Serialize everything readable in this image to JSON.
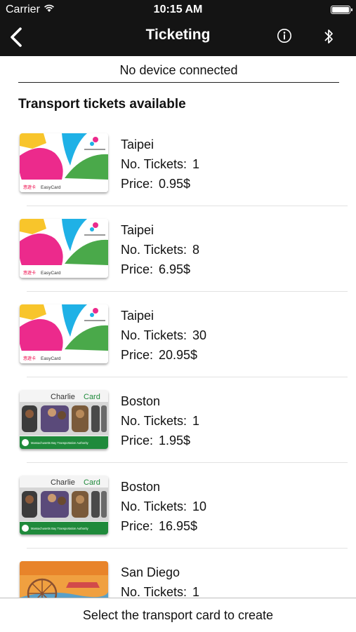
{
  "status_bar": {
    "carrier": "Carrier",
    "time": "10:15 AM"
  },
  "nav": {
    "title": "Ticketing"
  },
  "device_status": "No device connected",
  "section_title": "Transport tickets available",
  "labels": {
    "tickets": "No. Tickets:",
    "price": "Price:"
  },
  "tickets": [
    {
      "city": "Taipei",
      "count": "1",
      "price": "0.95$",
      "card": "easycard"
    },
    {
      "city": "Taipei",
      "count": "8",
      "price": "6.95$",
      "card": "easycard"
    },
    {
      "city": "Taipei",
      "count": "30",
      "price": "20.95$",
      "card": "easycard"
    },
    {
      "city": "Boston",
      "count": "1",
      "price": "1.95$",
      "card": "charliecard"
    },
    {
      "city": "Boston",
      "count": "10",
      "price": "16.95$",
      "card": "charliecard"
    },
    {
      "city": "San Diego",
      "count": "1",
      "price": "",
      "card": "sandiego"
    }
  ],
  "cards": {
    "easycard": {
      "brand": "EasyCard",
      "sub": "悠遊卡",
      "issuer": "台北捷運公司"
    },
    "charliecard": {
      "brand_a": "Charlie",
      "brand_b": "Card",
      "authority": "Massachusetts Bay Transportation Authority"
    }
  },
  "footer": {
    "prompt": "Select the transport card to create"
  },
  "colors": {
    "header_bg": "#141414",
    "easycard_yellow": "#f8c52b",
    "easycard_pink": "#ec2a8c",
    "easycard_blue": "#1fb1e6",
    "easycard_green": "#4aa94a",
    "charlie_green": "#1f8a3b"
  }
}
